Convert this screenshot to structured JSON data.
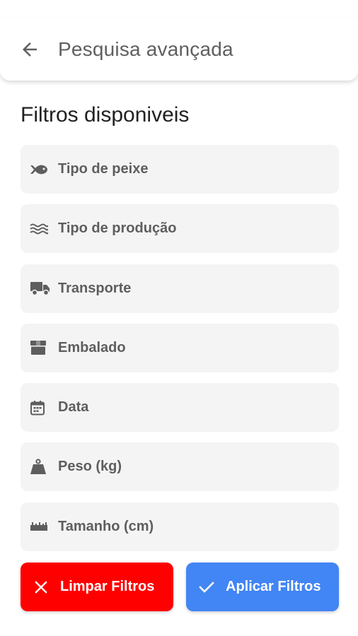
{
  "appbar": {
    "title": "Pesquisa avançada",
    "back_icon": "arrow-left-icon"
  },
  "section": {
    "title": "Filtros disponiveis"
  },
  "filters": [
    {
      "label": "Tipo de peixe",
      "icon": "fish-icon"
    },
    {
      "label": "Tipo de produção",
      "icon": "waves-icon"
    },
    {
      "label": "Transporte",
      "icon": "truck-icon"
    },
    {
      "label": "Embalado",
      "icon": "box-icon"
    },
    {
      "label": "Data",
      "icon": "calendar-icon"
    },
    {
      "label": "Peso (kg)",
      "icon": "weight-icon"
    },
    {
      "label": "Tamanho (cm)",
      "icon": "ruler-icon"
    }
  ],
  "buttons": {
    "clear": {
      "label": "Limpar Filtros",
      "icon": "close-icon",
      "color": "#ff0000"
    },
    "apply": {
      "label": "Aplicar Filtros",
      "icon": "check-icon",
      "color": "#4285f4"
    }
  }
}
